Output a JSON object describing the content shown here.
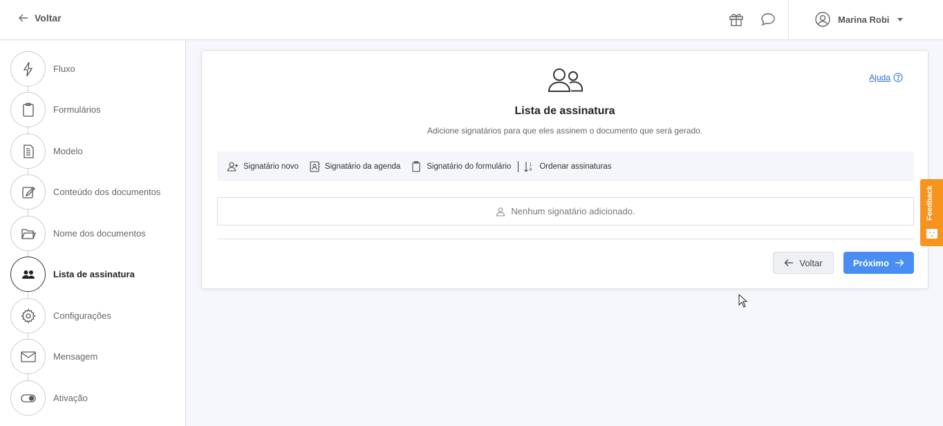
{
  "header": {
    "back_label": "Voltar",
    "user_name": "Marina Robi"
  },
  "sidebar": {
    "steps": [
      {
        "label": "Fluxo",
        "icon": "lightning-icon"
      },
      {
        "label": "Formulários",
        "icon": "clipboard-icon"
      },
      {
        "label": "Modelo",
        "icon": "document-icon"
      },
      {
        "label": "Conteúdo dos documentos",
        "icon": "edit-icon"
      },
      {
        "label": "Nome dos documentos",
        "icon": "folder-icon"
      },
      {
        "label": "Lista de assinatura",
        "icon": "users-icon",
        "active": true
      },
      {
        "label": "Configurações",
        "icon": "gear-icon"
      },
      {
        "label": "Mensagem",
        "icon": "envelope-icon"
      },
      {
        "label": "Ativação",
        "icon": "toggle-icon"
      }
    ]
  },
  "main": {
    "help_label": "Ajuda",
    "title": "Lista de assinatura",
    "subtitle": "Adicione signatários para que eles assinem o documento que será gerado.",
    "toolbar": {
      "new_signer": "Signatário novo",
      "agenda_signer": "Signatário da agenda",
      "form_signer": "Signatário do formulário",
      "order_signatures": "Ordenar assinaturas"
    },
    "empty_message": "Nenhum signatário adicionado.",
    "back_button": "Voltar",
    "next_button": "Próximo"
  },
  "feedback_label": "Feedback",
  "colors": {
    "primary": "#4a8ef3",
    "feedback": "#f7941d",
    "link": "#2a6fd6"
  }
}
